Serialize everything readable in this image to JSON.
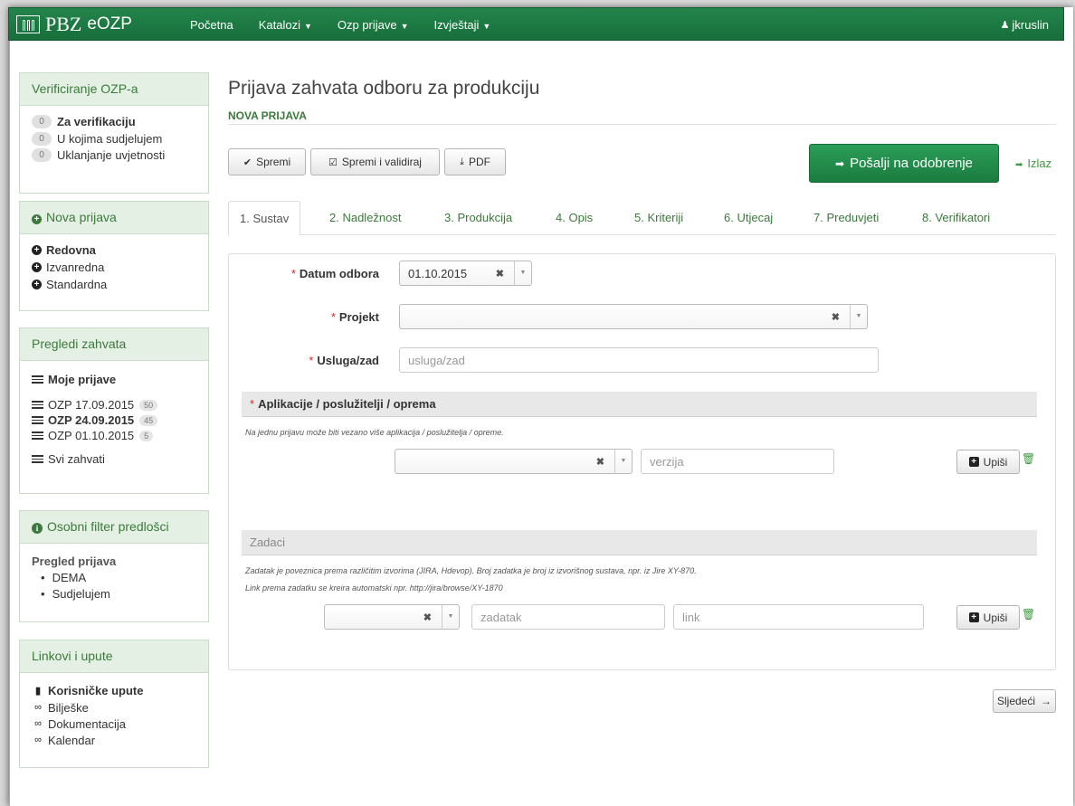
{
  "navbar": {
    "brand_pbz": "PBZ",
    "brand_eozp": "eOZP",
    "items": [
      "Početna",
      "Katalozi",
      "Ozp prijave",
      "Izvještaji"
    ],
    "user": "jkruslin"
  },
  "sidebar": {
    "verify": {
      "title": "Verificiranje OZP-a",
      "items": [
        {
          "count": "0",
          "label": "Za verifikaciju"
        },
        {
          "count": "0",
          "label": "U kojima sudjelujem"
        },
        {
          "count": "0",
          "label": "Uklanjanje uvjetnosti"
        }
      ]
    },
    "new_request": {
      "title": "Nova prijava",
      "items": [
        "Redovna",
        "Izvanredna",
        "Standardna"
      ]
    },
    "reviews": {
      "title": "Pregledi zahvata",
      "my": "Moje prijave",
      "items": [
        {
          "label": "OZP 17.09.2015",
          "count": "50"
        },
        {
          "label": "OZP 24.09.2015",
          "count": "45"
        },
        {
          "label": "OZP 01.10.2015",
          "count": "5"
        }
      ],
      "all": "Svi zahvati"
    },
    "filters": {
      "title": "Osobni filter predlošci",
      "subtitle": "Pregled prijava",
      "items": [
        "DEMA",
        "Sudjelujem"
      ]
    },
    "links": {
      "title": "Linkovi i upute",
      "items": [
        "Korisničke upute",
        "Bilješke",
        "Dokumentacija",
        "Kalendar"
      ]
    }
  },
  "main": {
    "title": "Prijava zahvata odboru za produkciju",
    "subtitle": "NOVA PRIJAVA",
    "toolbar": {
      "save": "Spremi",
      "save_validate": "Spremi i validiraj",
      "pdf": "PDF",
      "send": "Pošalji na odobrenje",
      "exit": "Izlaz"
    },
    "tabs": [
      "1. Sustav",
      "2. Nadležnost",
      "3. Produkcija",
      "4. Opis",
      "5. Kriteriji",
      "6. Utjecaj",
      "7. Preduvjeti",
      "8. Verifikatori"
    ],
    "form": {
      "date_label": "Datum odbora",
      "date_value": "01.10.2015",
      "project_label": "Projekt",
      "service_label": "Usluga/zad",
      "service_placeholder": "usluga/zad",
      "apps_title": "Aplikacije / poslužitelji / oprema",
      "apps_note": "Na jednu prijavu može biti vezano više aplikacija / poslužitelja / opreme.",
      "version_placeholder": "verzija",
      "enter": "Upiši",
      "tasks_title": "Zadaci",
      "tasks_note1": "Zadatak je poveznica prema različitim izvorima (JIRA, Hdevop). Broj zadatka je broj iz izvorišnog sustava, npr. iz Jire XY-870.",
      "tasks_note2": "Link prema zadatku se kreira automatski npr. http://jira/browse/XY-1870",
      "task_placeholder": "zadatak",
      "link_placeholder": "link"
    },
    "next": "Sljedeći"
  }
}
